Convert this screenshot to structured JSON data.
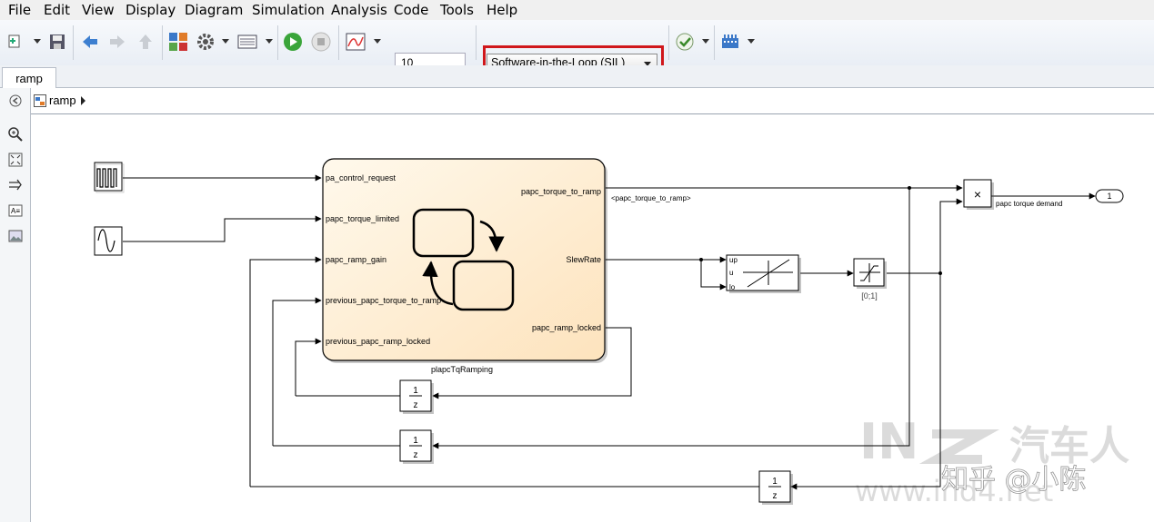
{
  "menu": {
    "items": [
      "File",
      "Edit",
      "View",
      "Display",
      "Diagram",
      "Simulation",
      "Analysis",
      "Code",
      "Tools",
      "Help"
    ]
  },
  "toolbar": {
    "stop_time": "10",
    "simulation_mode": "Software-in-the-Loop (SIL)",
    "icons": [
      "new-model-icon",
      "save-icon",
      "back-icon",
      "forward-icon",
      "up-icon",
      "library-browser-icon",
      "model-config-icon",
      "model-explorer-icon",
      "run-icon",
      "stop-icon",
      "scope-icon",
      "check-icon",
      "build-icon"
    ]
  },
  "tabs": [
    "ramp"
  ],
  "breadcrumb": {
    "model": "ramp"
  },
  "diagram": {
    "chart": {
      "name": "plapcTqRamping",
      "inputs": [
        "pa_control_request",
        "papc_torque_limited",
        "papc_ramp_gain",
        "previous_papc_torque_to_ramp",
        "previous_papc_ramp_locked"
      ],
      "outputs": [
        "papc_torque_to_ramp",
        "SlewRate",
        "papc_ramp_locked"
      ]
    },
    "signal_label": "<papc_torque_to_ramp>",
    "rate_limiter_ports": [
      "up",
      "u",
      "lo"
    ],
    "saturation_label": "[0;1]",
    "product_symbol": "×",
    "output_signal_label": "papc torque demand",
    "outport_number": "1",
    "delay": {
      "num": "1",
      "den": "z"
    }
  },
  "watermark": {
    "brand": "汽车人",
    "url": "www.ind4.net",
    "author": "知乎 @小陈"
  }
}
